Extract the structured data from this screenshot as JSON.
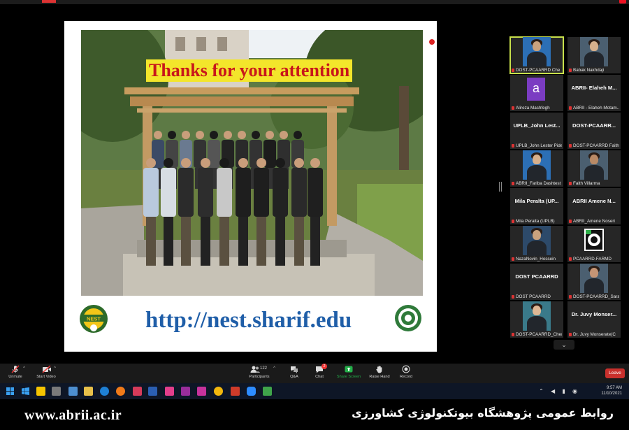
{
  "slide": {
    "title": "Thanks for your attention",
    "url": "http://nest.sharif.edu",
    "logo_left_text": "NEST"
  },
  "gallery": {
    "tiles": [
      {
        "label": "DOST-PCAARRD Che",
        "type": "video",
        "active": true
      },
      {
        "label": "Babak Nakhdaji",
        "type": "video"
      },
      {
        "label": "Alireza Mashfegh",
        "type": "avatar",
        "initial": "a"
      },
      {
        "big": "ABRII- Elaheh M...",
        "label": "ABRII - Elaheh Motam...",
        "type": "text"
      },
      {
        "big": "UPLB_John Lest...",
        "label": "UPLB_John Lester Pide",
        "type": "text"
      },
      {
        "big": "DOST-PCAARR...",
        "label": "DOST-PCAARRD Faith",
        "type": "text"
      },
      {
        "label": "ABRII_Fariba Dashtest",
        "type": "video"
      },
      {
        "label": "Faith Villarma",
        "type": "video"
      },
      {
        "big": "Mila Peralta (UP...",
        "label": "Mila Peralta (UPLB)",
        "type": "text"
      },
      {
        "big": "ABRII Amene N...",
        "label": "ABRII_Amene Noseri",
        "type": "text"
      },
      {
        "label": "NazaNovin_Hossein",
        "type": "video"
      },
      {
        "label": "PCAARRD-FARMD",
        "type": "logo"
      },
      {
        "big": "DOST PCAARRD",
        "label": "DOST PCAARRD",
        "type": "text"
      },
      {
        "label": "DOST-PCAARRD_Sara",
        "type": "video"
      },
      {
        "label": "DOST-PCAARRD_Cher",
        "type": "video"
      },
      {
        "big": "Dr. Juvy Monser...",
        "label": "Dr. Juvy Monserate(C",
        "type": "text"
      }
    ],
    "scroll_icon": "chevron-down-icon"
  },
  "toolbar": {
    "unmute": "Unmute",
    "start_video": "Start Video",
    "participants": "Participants",
    "participants_count": "122",
    "qa": "Q&A",
    "chat": "Chat",
    "chat_badge": "2",
    "share_screen": "Share Screen",
    "raise_hand": "Raise Hand",
    "record": "Record",
    "leave": "Leave"
  },
  "taskbar": {
    "time": "9:57 AM",
    "date": "11/10/2021"
  },
  "caption": {
    "url": "www.abrii.ac.ir",
    "persian": "روابط عمومی پژوهشگاه بیوتکنولوژی کشاورزی"
  },
  "colors": {
    "accent_green": "#24b04a",
    "leave_red": "#c9302c",
    "title_bg": "#f3e62b",
    "title_red": "#c8161b",
    "url_blue": "#1f5ea8"
  }
}
